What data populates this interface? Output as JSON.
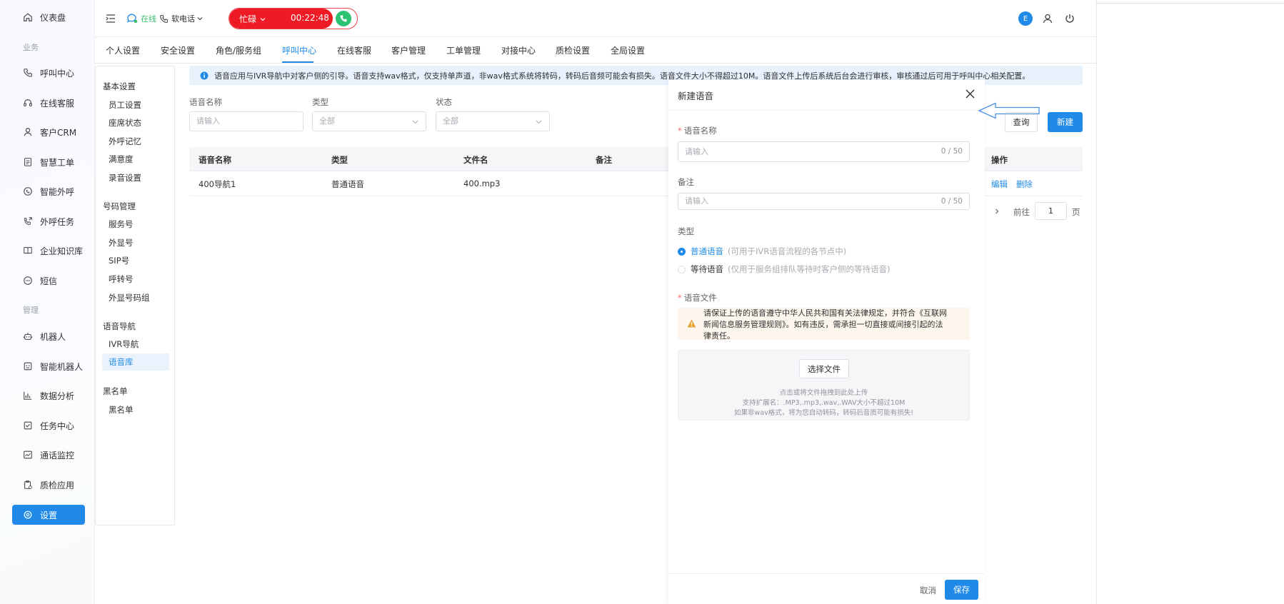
{
  "sidebar": {
    "groups": {
      "business": "业务",
      "manage": "管理"
    },
    "items": [
      {
        "key": "dashboard",
        "label": "仪表盘",
        "icon": "home-icon"
      },
      {
        "key": "call-center",
        "label": "呼叫中心",
        "icon": "phone-icon"
      },
      {
        "key": "online-service",
        "label": "在线客服",
        "icon": "headset-icon"
      },
      {
        "key": "crm",
        "label": "客户CRM",
        "icon": "user-icon"
      },
      {
        "key": "ticket",
        "label": "智慧工单",
        "icon": "document-icon"
      },
      {
        "key": "smart-outbound",
        "label": "智能外呼",
        "icon": "whatsapp-icon"
      },
      {
        "key": "outbound-task",
        "label": "外呼任务",
        "icon": "phone-outgoing-icon"
      },
      {
        "key": "knowledge",
        "label": "企业知识库",
        "icon": "book-icon"
      },
      {
        "key": "sms",
        "label": "短信",
        "icon": "message-dots-icon"
      },
      {
        "key": "robot",
        "label": "机器人",
        "icon": "robot-icon"
      },
      {
        "key": "smart-robot",
        "label": "智能机器人",
        "icon": "robot-face-icon"
      },
      {
        "key": "analytics",
        "label": "数据分析",
        "icon": "bar-chart-icon"
      },
      {
        "key": "task-center",
        "label": "任务中心",
        "icon": "checkbox-icon"
      },
      {
        "key": "call-monitor",
        "label": "通话监控",
        "icon": "monitor-chart-icon"
      },
      {
        "key": "qa-app",
        "label": "质检应用",
        "icon": "clipboard-icon"
      },
      {
        "key": "settings",
        "label": "设置",
        "icon": "gear-icon"
      }
    ]
  },
  "topbar": {
    "status": "在线",
    "phone_mode": "软电话",
    "call_status": "忙碌",
    "call_timer": "00:22:48",
    "avatar_letter": "E"
  },
  "tabs": [
    "个人设置",
    "安全设置",
    "角色/服务组",
    "呼叫中心",
    "在线客服",
    "客户管理",
    "工单管理",
    "对接中心",
    "质检设置",
    "全局设置"
  ],
  "subnav": {
    "basic": {
      "title": "基本设置",
      "items": [
        "员工设置",
        "座席状态",
        "外呼记忆",
        "满意度",
        "录音设置"
      ]
    },
    "numbers": {
      "title": "号码管理",
      "items": [
        "服务号",
        "外显号",
        "SIP号",
        "呼转号",
        "外显号码组"
      ]
    },
    "voice": {
      "title": "语音导航",
      "items": [
        "IVR导航",
        "语音库"
      ]
    },
    "blacklist": {
      "title": "黑名单",
      "items": [
        "黑名单"
      ]
    }
  },
  "main": {
    "info": "语音应用与IVR导航中对客户侧的引导。语音支持wav格式，仅支持单声道，非wav格式系统将转码，转码后音频可能会有损失。语音文件大小不得超过10M。语音文件上传后系统后台会进行审核，审核通过后可用于呼叫中心相关配置。",
    "filters": {
      "name_label": "语音名称",
      "name_placeholder": "请输入",
      "type_label": "类型",
      "type_value": "全部",
      "status_label": "状态",
      "status_value": "全部"
    },
    "query_label": "查询",
    "new_label": "新建",
    "table": {
      "headers": [
        "语音名称",
        "类型",
        "文件名",
        "备注",
        "操作"
      ],
      "rows": [
        {
          "name": "400导航1",
          "type": "普通语音",
          "file": "400.mp3",
          "remark": ""
        }
      ],
      "ops": [
        "编辑",
        "删除"
      ]
    },
    "pager": {
      "goto": "前往",
      "page": "1",
      "suffix": "页"
    }
  },
  "drawer": {
    "title": "新建语音",
    "name_label": "语音名称",
    "name_placeholder": "请输入",
    "name_count": "0 / 50",
    "remark_label": "备注",
    "remark_placeholder": "请输入",
    "remark_count": "0 / 50",
    "type_label": "类型",
    "type_options": [
      {
        "label": "普通语音",
        "desc": "(可用于IVR语音流程的各节点中)",
        "checked": true
      },
      {
        "label": "等待语音",
        "desc": "(仅用于服务组排队等待时客户侧的等待语音)",
        "checked": false
      }
    ],
    "file_label": "语音文件",
    "warning_line1": "请保证上传的语音遵守中华人民共和国有关法律规定，并符合《互联网",
    "warning_line2": "新闻信息服务管理规则》。如有违反，需承担一切直接或间接引起的法",
    "warning_line3": "律责任。",
    "upload_button": "选择文件",
    "upload_hint1": "点击或将文件拖拽到此处上传",
    "upload_hint2": "支持扩展名：.MP3,.mp3,.wav,.WAV大小不超过10M",
    "upload_hint3": "如果非wav格式，将为您自动转码，转码后音质可能有损失!",
    "cancel": "取消",
    "save": "保存"
  },
  "colors": {
    "primary": "#1f8ae8",
    "danger": "#ee1b25",
    "success": "#2ec273",
    "warning_bg": "#fdf6ec"
  }
}
